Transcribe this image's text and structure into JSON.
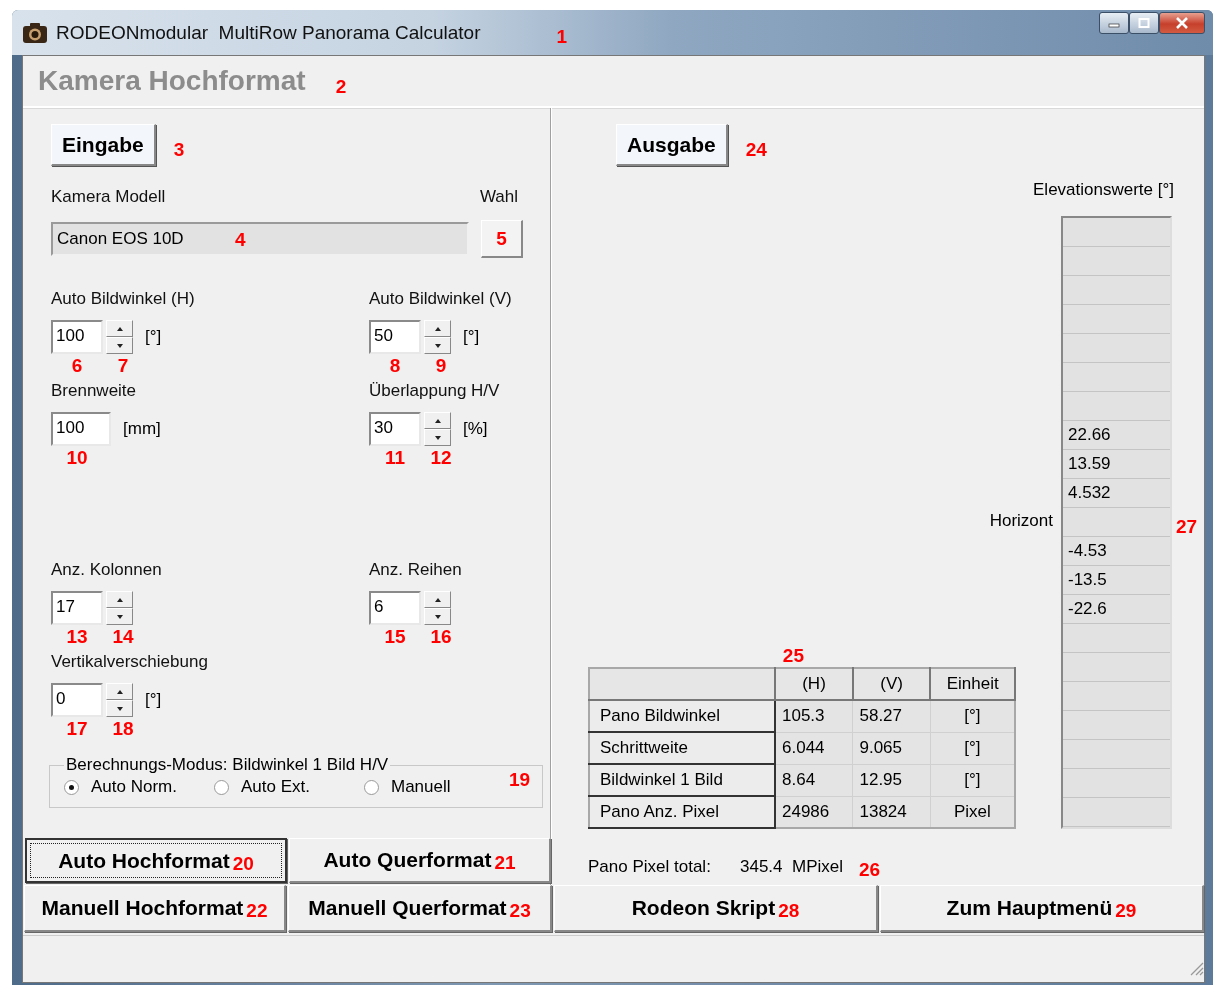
{
  "window": {
    "title": "RODEONmodular  MultiRow Panorama Calculator",
    "marker": "1"
  },
  "header": {
    "title": "Kamera Hochformat",
    "marker": "2"
  },
  "input_panel": {
    "button": {
      "label": "Eingabe",
      "marker": "3"
    },
    "camera": {
      "label": "Kamera Modell",
      "value": "Canon EOS 10D",
      "marker": "4",
      "choose_label": "Wahl",
      "choose_marker": "5"
    },
    "fields": [
      {
        "kind": "spin",
        "label": "Auto Bildwinkel (H)",
        "value": "100",
        "unit": "[°]",
        "markers": [
          "6",
          "7"
        ]
      },
      {
        "kind": "spin",
        "label": "Auto Bildwinkel (V)",
        "value": "50",
        "unit": "[°]",
        "markers": [
          "8",
          "9"
        ]
      },
      {
        "kind": "text",
        "label": "Brennweite",
        "value": "100",
        "unit": "[mm]",
        "markers": [
          "10"
        ]
      },
      {
        "kind": "spin",
        "label": "Überlappung H/V",
        "value": "30",
        "unit": "[%]",
        "markers": [
          "11",
          "12"
        ]
      },
      {
        "kind": "spin",
        "label": "Anz. Kolonnen",
        "value": "17",
        "markers": [
          "13",
          "14"
        ]
      },
      {
        "kind": "spin",
        "label": "Anz. Reihen",
        "value": "6",
        "markers": [
          "15",
          "16"
        ]
      },
      {
        "kind": "spin",
        "label": "Vertikalverschiebung",
        "value": "0",
        "unit": "[°]",
        "markers": [
          "17",
          "18"
        ]
      }
    ],
    "mode_group": {
      "title": "Berechnungs-Modus: Bildwinkel 1 Bild H/V",
      "marker": "19",
      "options": [
        {
          "label": "Auto Norm.",
          "selected": true
        },
        {
          "label": "Auto Ext.",
          "selected": false
        },
        {
          "label": "Manuell",
          "selected": false
        }
      ]
    },
    "buttons": [
      {
        "label": "Auto Hochformat",
        "marker": "20",
        "focused": true
      },
      {
        "label": "Auto Querformat",
        "marker": "21",
        "focused": false
      }
    ]
  },
  "output_panel": {
    "button": {
      "label": "Ausgabe",
      "marker": "24"
    },
    "table": {
      "marker": "25",
      "columns": [
        "(H)",
        "(V)",
        "Einheit"
      ],
      "rows": [
        {
          "label": "Pano Bildwinkel",
          "cells": [
            "105.3",
            "58.27",
            "[°]"
          ]
        },
        {
          "label": "Schrittweite",
          "cells": [
            "6.044",
            "9.065",
            "[°]"
          ]
        },
        {
          "label": "Bildwinkel 1 Bild",
          "cells": [
            "8.64",
            "12.95",
            "[°]"
          ]
        },
        {
          "label": "Pano Anz. Pixel",
          "cells": [
            "24986",
            "13824",
            "Pixel"
          ]
        }
      ]
    },
    "total": {
      "label": "Pano Pixel total:",
      "value": "345.4  MPixel",
      "marker": "26"
    },
    "elevation": {
      "title": "Elevationswerte [°]",
      "marker": "27",
      "rows": [
        {
          "kind": "blank"
        },
        {
          "kind": "blank"
        },
        {
          "kind": "blank"
        },
        {
          "kind": "blank"
        },
        {
          "kind": "blank"
        },
        {
          "kind": "blank"
        },
        {
          "kind": "blank"
        },
        {
          "kind": "value",
          "value": "22.66"
        },
        {
          "kind": "value",
          "value": "13.59"
        },
        {
          "kind": "value",
          "value": "4.532"
        },
        {
          "kind": "horizon",
          "label": "Horizont"
        },
        {
          "kind": "value",
          "value": "-4.53"
        },
        {
          "kind": "value",
          "value": "-13.5"
        },
        {
          "kind": "value",
          "value": "-22.6"
        },
        {
          "kind": "blank"
        },
        {
          "kind": "blank"
        },
        {
          "kind": "blank"
        },
        {
          "kind": "blank"
        },
        {
          "kind": "blank"
        },
        {
          "kind": "blank"
        },
        {
          "kind": "blank"
        }
      ]
    }
  },
  "bottom_buttons": [
    {
      "label": "Manuell Hochformat",
      "marker": "22",
      "focused": false
    },
    {
      "label": "Manuell Querformat",
      "marker": "23",
      "focused": false
    },
    {
      "label": "Rodeon Skript",
      "marker": "28",
      "focused": false
    },
    {
      "label": "Zum Hauptmenü",
      "marker": "29",
      "focused": false
    }
  ]
}
